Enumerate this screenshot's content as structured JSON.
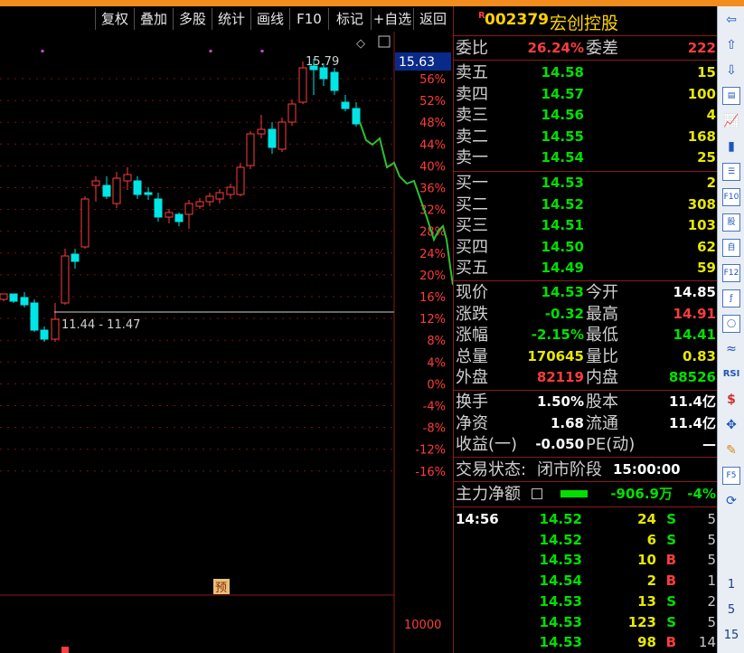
{
  "toolbar": {
    "items": [
      "复权",
      "叠加",
      "多股",
      "统计",
      "画线",
      "F10",
      "标记",
      "+自选",
      "返回"
    ]
  },
  "chart": {
    "last_price_box": "15.63",
    "peak_label": "15.79",
    "low_range_label": "11.44 - 11.47",
    "pct_axis": [
      "56%",
      "52%",
      "48%",
      "44%",
      "40%",
      "36%",
      "32%",
      "28%",
      "24%",
      "20%",
      "16%",
      "12%",
      "8%",
      "4%",
      "0%",
      "-4%",
      "-8%",
      "-12%",
      "-16%"
    ],
    "volume_axis_label": "10000",
    "yu_badge": "预",
    "colors": {
      "up": "#ff3c3c",
      "down": "#00e5e5",
      "intraday": "#2fbf2f",
      "grid": "#7a1010"
    }
  },
  "quote": {
    "code": "002379",
    "name": "宏创控股",
    "badge": "R",
    "weibi_label": "委比",
    "weibi_value": "26.24%",
    "weicha_label": "委差",
    "weicha_value": "222",
    "asks": [
      {
        "label": "卖五",
        "price": "14.58",
        "vol": "15"
      },
      {
        "label": "卖四",
        "price": "14.57",
        "vol": "100"
      },
      {
        "label": "卖三",
        "price": "14.56",
        "vol": "4"
      },
      {
        "label": "卖二",
        "price": "14.55",
        "vol": "168"
      },
      {
        "label": "卖一",
        "price": "14.54",
        "vol": "25"
      }
    ],
    "bids": [
      {
        "label": "买一",
        "price": "14.53",
        "vol": "2"
      },
      {
        "label": "买二",
        "price": "14.52",
        "vol": "308"
      },
      {
        "label": "买三",
        "price": "14.51",
        "vol": "103"
      },
      {
        "label": "买四",
        "price": "14.50",
        "vol": "62"
      },
      {
        "label": "买五",
        "price": "14.49",
        "vol": "59"
      }
    ],
    "stats": [
      {
        "l1": "现价",
        "v1": "14.53",
        "l2": "今开",
        "v2": "14.85"
      },
      {
        "l1": "涨跌",
        "v1": "-0.32",
        "l2": "最高",
        "v2": "14.91"
      },
      {
        "l1": "涨幅",
        "v1": "-2.15%",
        "l2": "最低",
        "v2": "14.41"
      },
      {
        "l1": "总量",
        "v1": "170645",
        "l2": "量比",
        "v2": "0.83"
      },
      {
        "l1": "外盘",
        "v1": "82119",
        "l2": "内盘",
        "v2": "88526"
      }
    ],
    "fund": [
      {
        "l1": "换手",
        "v1": "1.50%",
        "l2": "股本",
        "v2": "11.4亿"
      },
      {
        "l1": "净资",
        "v1": "1.68",
        "l2": "流通",
        "v2": "11.4亿"
      },
      {
        "l1": "收益(一)",
        "v1": "-0.050",
        "l2": "PE(动)",
        "v2": "—"
      }
    ],
    "status_label": "交易状态:",
    "status_value": "闭市阶段",
    "status_time": "15:00:00",
    "main_flow_label": "主力净额",
    "main_flow_value": "-906.9万",
    "main_flow_pct": "-4%",
    "ticks": [
      {
        "time": "14:56",
        "price": "14.52",
        "vol": "24",
        "side": "S",
        "n": "5"
      },
      {
        "time": "",
        "price": "14.52",
        "vol": "6",
        "side": "S",
        "n": "5"
      },
      {
        "time": "",
        "price": "14.53",
        "vol": "10",
        "side": "B",
        "n": "5"
      },
      {
        "time": "",
        "price": "14.54",
        "vol": "2",
        "side": "B",
        "n": "1"
      },
      {
        "time": "",
        "price": "14.53",
        "vol": "13",
        "side": "S",
        "n": "2"
      },
      {
        "time": "",
        "price": "14.53",
        "vol": "123",
        "side": "S",
        "n": "5"
      },
      {
        "time": "",
        "price": "14.53",
        "vol": "98",
        "side": "B",
        "n": "14"
      }
    ]
  },
  "sidebar": {
    "icons": [
      "arrow-left-icon",
      "arrow-up-icon",
      "arrow-down-icon",
      "report-icon",
      "trend-icon",
      "candle-icon",
      "list-icon",
      "f10-icon",
      "holder-icon",
      "self-icon",
      "f12-icon",
      "fx-icon",
      "circle-icon",
      "wave-icon",
      "rsi-icon",
      "dollar-icon",
      "move-icon",
      "pencil-icon",
      "f5-icon",
      "refresh-icon"
    ],
    "rsi_text": "RSI",
    "f10_text": "F10",
    "f12_text": "F12",
    "f5_text": "F5",
    "nums": [
      "1",
      "5",
      "15"
    ]
  }
}
